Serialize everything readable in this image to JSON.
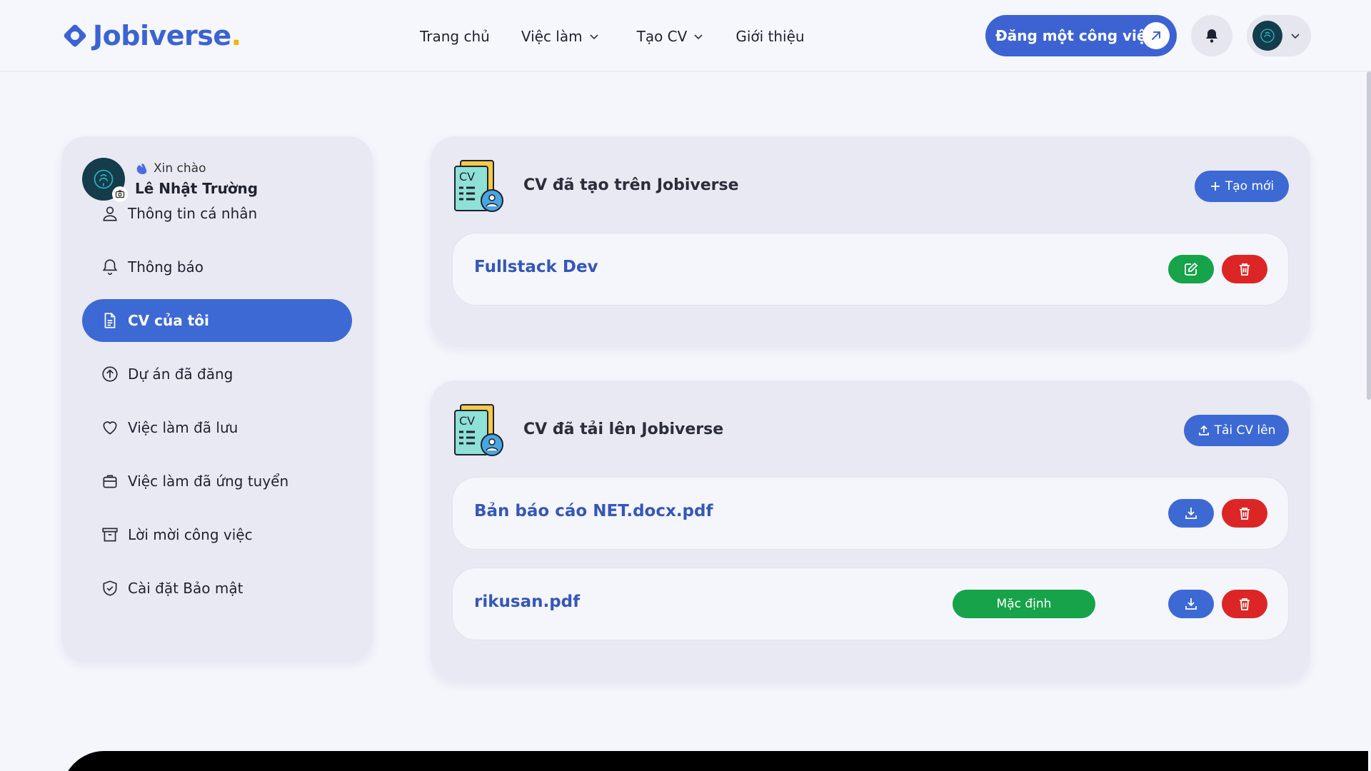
{
  "brand": {
    "name": "Jobiverse",
    "dot": ".",
    "color": "#3b63d2",
    "dot_color": "#f4b400"
  },
  "nav": {
    "items": [
      {
        "label": "Trang chủ",
        "has_dropdown": false
      },
      {
        "label": "Việc làm",
        "has_dropdown": true
      },
      {
        "label": "Tạo CV",
        "has_dropdown": true
      },
      {
        "label": "Giới thiệu",
        "has_dropdown": false
      }
    ],
    "post_job_label": "Đăng một công việc"
  },
  "profile": {
    "greeting": "Xin chào",
    "name": "Lê Nhật Trường"
  },
  "sidebar": {
    "items": [
      {
        "label": "Thông tin cá nhân",
        "icon": "user-icon",
        "active": false
      },
      {
        "label": "Thông báo",
        "icon": "bell-icon",
        "active": false
      },
      {
        "label": "CV của tôi",
        "icon": "document-icon",
        "active": true
      },
      {
        "label": "Dự án đã đăng",
        "icon": "upload-circle-icon",
        "active": false
      },
      {
        "label": "Việc làm đã lưu",
        "icon": "heart-icon",
        "active": false
      },
      {
        "label": "Việc làm đã ứng tuyển",
        "icon": "briefcase-icon",
        "active": false
      },
      {
        "label": "Lời mời công việc",
        "icon": "archive-icon",
        "active": false
      },
      {
        "label": "Cài đặt Bảo mật",
        "icon": "shield-check-icon",
        "active": false
      }
    ]
  },
  "created_cvs": {
    "title": "CV đã tạo trên Jobiverse",
    "create_label": "Tạo mới",
    "items": [
      {
        "name": "Fullstack Dev"
      }
    ]
  },
  "uploaded_cvs": {
    "title": "CV đã tải lên Jobiverse",
    "upload_label": "Tải CV lên",
    "items": [
      {
        "name": "Bản báo cáo NET.docx.pdf",
        "is_default": false
      },
      {
        "name": "rikusan.pdf",
        "is_default": true,
        "default_label": "Mặc định"
      }
    ]
  },
  "colors": {
    "primary": "#3d69d4",
    "success": "#16a34a",
    "danger": "#dc2626"
  }
}
